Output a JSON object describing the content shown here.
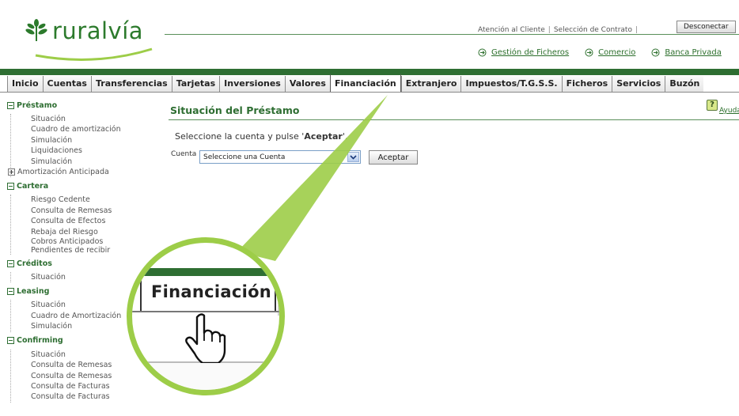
{
  "brand": {
    "name": "ruralvía",
    "color": "#2c7a2c"
  },
  "header": {
    "links": [
      "Atención al Cliente",
      "Selección de Contrato"
    ],
    "disconnect_label": "Desconectar",
    "ext_links": [
      "Gestión de Ficheros",
      "Comercio",
      "Banca Privada"
    ]
  },
  "tabs": [
    "Inicio",
    "Cuentas",
    "Transferencias",
    "Tarjetas",
    "Inversiones",
    "Valores",
    "Financiación",
    "Extranjero",
    "Impuestos/T.G.S.S.",
    "Ficheros",
    "Servicios",
    "Buzón"
  ],
  "active_tab": "Financiación",
  "sidebar": {
    "sections": [
      {
        "title": "Préstamo",
        "items": [
          "Situación",
          "Cuadro de amortización",
          "Simulación",
          "Liquidaciones",
          "Simulación"
        ],
        "expandable": "Amortización Anticipada"
      },
      {
        "title": "Cartera",
        "items": [
          "Riesgo Cedente",
          "Consulta de Remesas",
          "Consulta de Efectos",
          "Rebaja del Riesgo",
          "Cobros Anticipados",
          "Pendientes de recibir"
        ]
      },
      {
        "title": "Créditos",
        "items": [
          "Situación"
        ]
      },
      {
        "title": "Leasing",
        "items": [
          "Situación",
          "Cuadro de Amortización",
          "Simulación"
        ]
      },
      {
        "title": "Confirming",
        "items": [
          "Situación",
          "Consulta de Remesas",
          "Consulta de Remesas",
          "Consulta de Facturas",
          "Consulta de Facturas"
        ]
      }
    ]
  },
  "main": {
    "title": "Situación del Préstamo",
    "help_label": "Ayuda",
    "instruction_prefix": "Seleccione la cuenta y pulse '",
    "instruction_bold": "Aceptar",
    "instruction_suffix": "'.",
    "cuenta_label": "Cuenta",
    "cuenta_value": "Seleccione una Cuenta",
    "accept_label": "Aceptar"
  },
  "magnifier": {
    "tab_label": "Financiación"
  },
  "colors": {
    "brand_green": "#2e6e32",
    "callout_green": "#9dcd48",
    "link_green": "#2c6f2c"
  }
}
